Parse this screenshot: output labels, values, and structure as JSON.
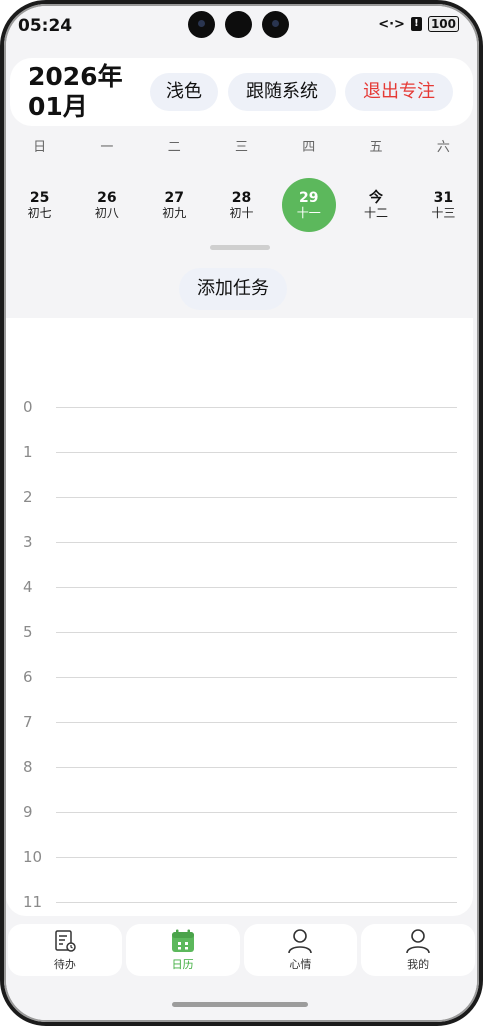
{
  "status": {
    "time": "05:24",
    "signal": "<·>",
    "alert": "!",
    "battery": "100"
  },
  "header": {
    "year_month_line1": "2026年",
    "year_month_line2": "01月",
    "btn_light": "浅色",
    "btn_system": "跟随系统",
    "btn_exit_focus": "退出专注"
  },
  "weekdays": [
    "日",
    "一",
    "二",
    "三",
    "四",
    "五",
    "六"
  ],
  "dates": [
    {
      "num": "25",
      "lunar": "初七"
    },
    {
      "num": "26",
      "lunar": "初八"
    },
    {
      "num": "27",
      "lunar": "初九"
    },
    {
      "num": "28",
      "lunar": "初十"
    },
    {
      "num": "29",
      "lunar": "十一"
    },
    {
      "num": "今",
      "lunar": "十二"
    },
    {
      "num": "31",
      "lunar": "十三"
    }
  ],
  "add_task_label": "添加任务",
  "hours": [
    "0",
    "1",
    "2",
    "3",
    "4",
    "5",
    "6",
    "7",
    "8",
    "9",
    "10",
    "11"
  ],
  "nav": [
    {
      "label": "待办",
      "icon": "todo-list-icon"
    },
    {
      "label": "日历",
      "icon": "calendar-icon"
    },
    {
      "label": "心情",
      "icon": "person-icon"
    },
    {
      "label": "我的",
      "icon": "person-icon"
    }
  ],
  "colors": {
    "accent_green": "#5cb85c",
    "exit_red": "#e53935",
    "pill_bg": "#eef1f8"
  }
}
